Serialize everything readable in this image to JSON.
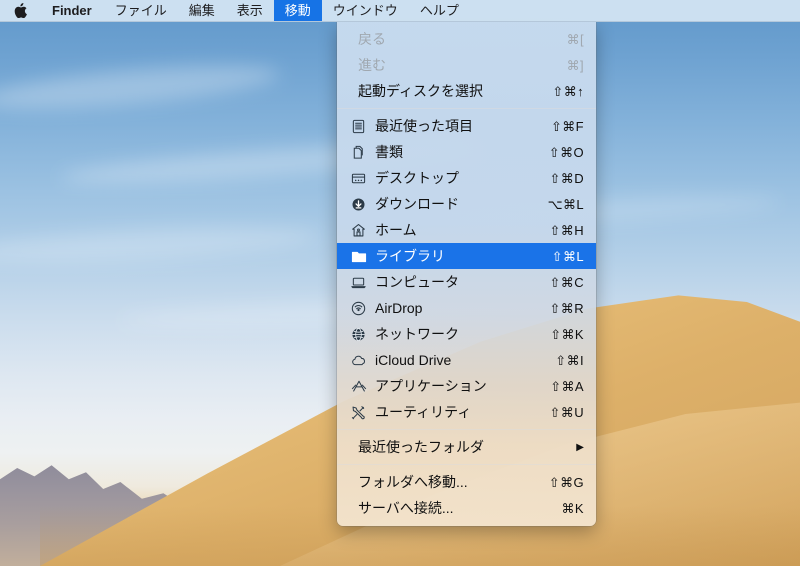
{
  "menubar": {
    "apple_icon": "apple-logo-icon",
    "items": [
      {
        "label": "Finder",
        "bold": true,
        "active": false
      },
      {
        "label": "ファイル",
        "bold": false,
        "active": false
      },
      {
        "label": "編集",
        "bold": false,
        "active": false
      },
      {
        "label": "表示",
        "bold": false,
        "active": false
      },
      {
        "label": "移動",
        "bold": false,
        "active": true
      },
      {
        "label": "ウインドウ",
        "bold": false,
        "active": false
      },
      {
        "label": "ヘルプ",
        "bold": false,
        "active": false
      }
    ]
  },
  "go_menu": {
    "title": "移動",
    "highlight_color": "#1a73e8",
    "groups": [
      {
        "items": [
          {
            "label": "戻る",
            "shortcut": "⌘[",
            "icon": null,
            "disabled": true,
            "selected": false,
            "submenu": false
          },
          {
            "label": "進む",
            "shortcut": "⌘]",
            "icon": null,
            "disabled": true,
            "selected": false,
            "submenu": false
          },
          {
            "label": "起動ディスクを選択",
            "shortcut": "⇧⌘↑",
            "icon": null,
            "disabled": false,
            "selected": false,
            "submenu": false
          }
        ]
      },
      {
        "items": [
          {
            "label": "最近使った項目",
            "shortcut": "⇧⌘F",
            "icon": "recent-items-icon",
            "disabled": false,
            "selected": false,
            "submenu": false
          },
          {
            "label": "書類",
            "shortcut": "⇧⌘O",
            "icon": "documents-icon",
            "disabled": false,
            "selected": false,
            "submenu": false
          },
          {
            "label": "デスクトップ",
            "shortcut": "⇧⌘D",
            "icon": "desktop-icon",
            "disabled": false,
            "selected": false,
            "submenu": false
          },
          {
            "label": "ダウンロード",
            "shortcut": "⌥⌘L",
            "icon": "downloads-icon",
            "disabled": false,
            "selected": false,
            "submenu": false
          },
          {
            "label": "ホーム",
            "shortcut": "⇧⌘H",
            "icon": "home-icon",
            "disabled": false,
            "selected": false,
            "submenu": false
          },
          {
            "label": "ライブラリ",
            "shortcut": "⇧⌘L",
            "icon": "folder-icon",
            "disabled": false,
            "selected": true,
            "submenu": false
          },
          {
            "label": "コンピュータ",
            "shortcut": "⇧⌘C",
            "icon": "computer-icon",
            "disabled": false,
            "selected": false,
            "submenu": false
          },
          {
            "label": "AirDrop",
            "shortcut": "⇧⌘R",
            "icon": "airdrop-icon",
            "disabled": false,
            "selected": false,
            "submenu": false
          },
          {
            "label": "ネットワーク",
            "shortcut": "⇧⌘K",
            "icon": "network-icon",
            "disabled": false,
            "selected": false,
            "submenu": false
          },
          {
            "label": "iCloud Drive",
            "shortcut": "⇧⌘I",
            "icon": "icloud-icon",
            "disabled": false,
            "selected": false,
            "submenu": false
          },
          {
            "label": "アプリケーション",
            "shortcut": "⇧⌘A",
            "icon": "applications-icon",
            "disabled": false,
            "selected": false,
            "submenu": false
          },
          {
            "label": "ユーティリティ",
            "shortcut": "⇧⌘U",
            "icon": "utilities-icon",
            "disabled": false,
            "selected": false,
            "submenu": false
          }
        ]
      },
      {
        "items": [
          {
            "label": "最近使ったフォルダ",
            "shortcut": "",
            "icon": null,
            "disabled": false,
            "selected": false,
            "submenu": true
          }
        ]
      },
      {
        "items": [
          {
            "label": "フォルダへ移動...",
            "shortcut": "⇧⌘G",
            "icon": null,
            "disabled": false,
            "selected": false,
            "submenu": false
          },
          {
            "label": "サーバへ接続...",
            "shortcut": "⌘K",
            "icon": null,
            "disabled": false,
            "selected": false,
            "submenu": false
          }
        ]
      }
    ]
  },
  "desktop": {
    "wallpaper": "mojave-sand-dunes",
    "sky_color": "#6ea2d1",
    "sand_color": "#e8c07a"
  }
}
